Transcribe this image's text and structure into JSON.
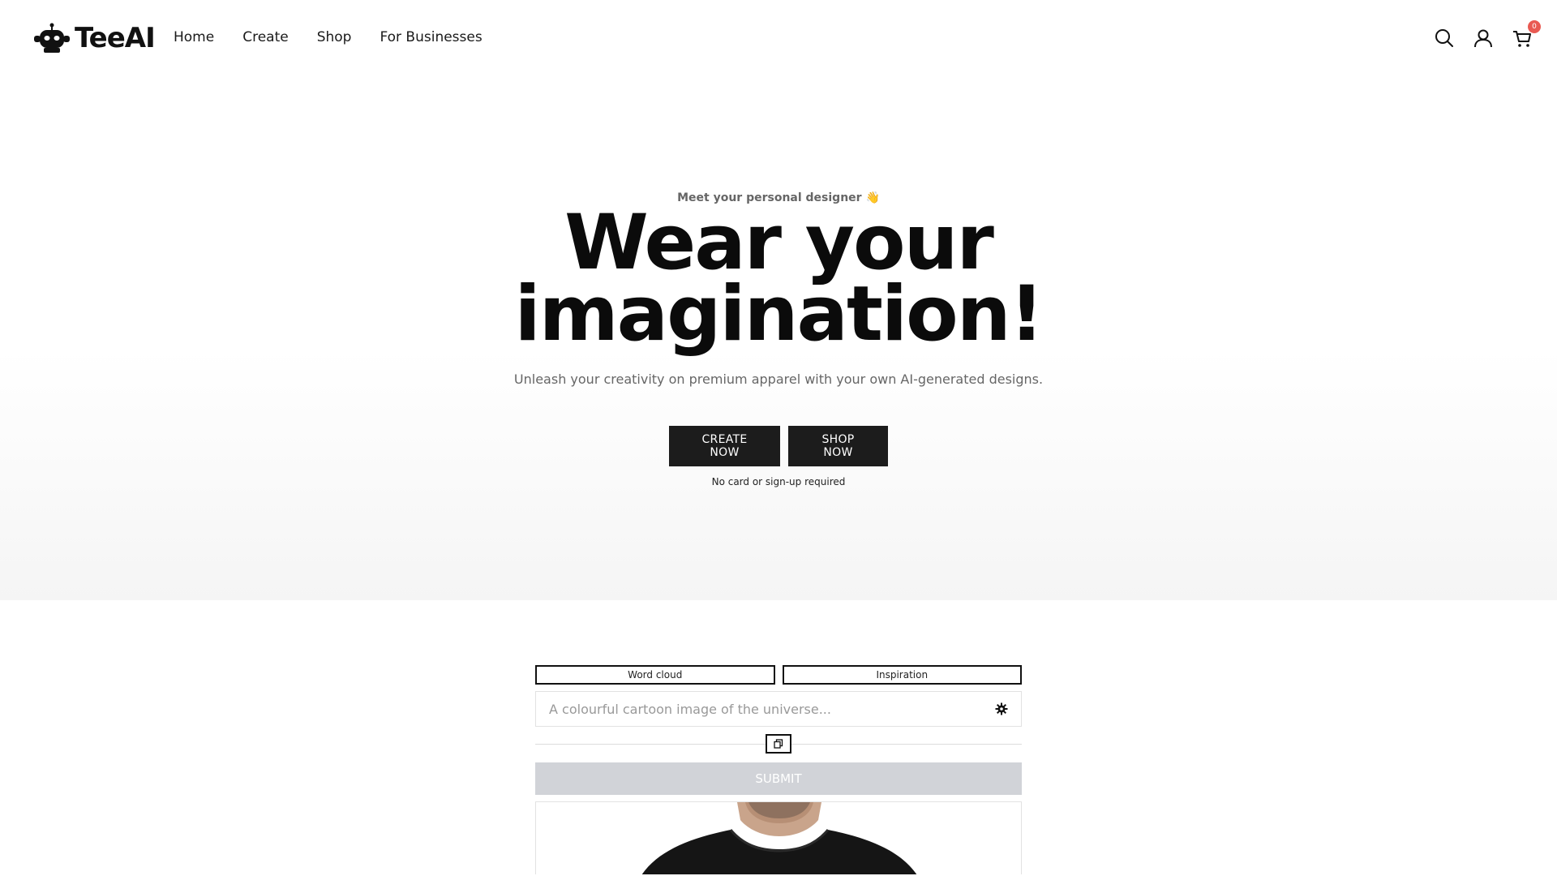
{
  "brand": {
    "name": "TeeAI"
  },
  "nav": {
    "items": [
      "Home",
      "Create",
      "Shop",
      "For Businesses"
    ]
  },
  "header": {
    "cart_count": "0",
    "icons": [
      "search-icon",
      "user-icon",
      "cart-icon"
    ]
  },
  "hero": {
    "eyebrow": "Meet your personal designer",
    "eyebrow_emoji": "👋",
    "title_line1": "Wear your",
    "title_line2": "imagination!",
    "subtitle": "Unleash your creativity on premium apparel with your own AI-generated designs.",
    "create_button": "CREATE NOW",
    "shop_button": "SHOP NOW",
    "note": "No card or sign-up required"
  },
  "generator": {
    "tabs": [
      "Word cloud",
      "Inspiration"
    ],
    "prompt_placeholder": "A colourful cartoon image of the universe...",
    "submit_label": "SUBMIT"
  },
  "colors": {
    "accent_dark": "#1c1c1c",
    "cart_badge": "#e95a52",
    "submit_disabled": "#d1d3d8"
  }
}
